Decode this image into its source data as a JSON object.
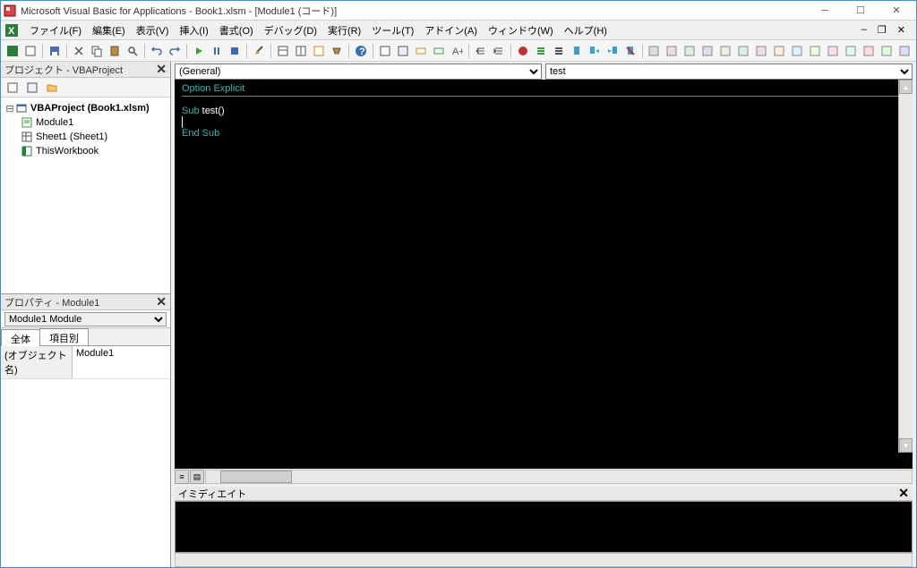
{
  "title": "Microsoft Visual Basic for Applications - Book1.xlsm - [Module1 (コード)]",
  "menu": {
    "file": "ファイル(F)",
    "edit": "編集(E)",
    "view": "表示(V)",
    "insert": "挿入(I)",
    "format": "書式(O)",
    "debug": "デバッグ(D)",
    "run": "実行(R)",
    "tools": "ツール(T)",
    "addins": "アドイン(A)",
    "window": "ウィンドウ(W)",
    "help": "ヘルプ(H)"
  },
  "project_pane": {
    "title": "プロジェクト - VBAProject",
    "root": "VBAProject (Book1.xlsm)",
    "items": [
      "Module1",
      "Sheet1 (Sheet1)",
      "ThisWorkbook"
    ]
  },
  "properties_pane": {
    "title": "プロパティ - Module1",
    "object": "Module1 Module",
    "tabs": [
      "全体",
      "項目別"
    ],
    "rows": [
      {
        "k": "(オブジェクト名)",
        "v": "Module1"
      }
    ]
  },
  "code": {
    "object_dropdown": "(General)",
    "proc_dropdown": "test",
    "line1_kw": "Option Explicit",
    "line2_kw": "Sub",
    "line2_name": " test()",
    "line3_kw": "End Sub"
  },
  "immediate": {
    "title": "イミディエイト"
  }
}
